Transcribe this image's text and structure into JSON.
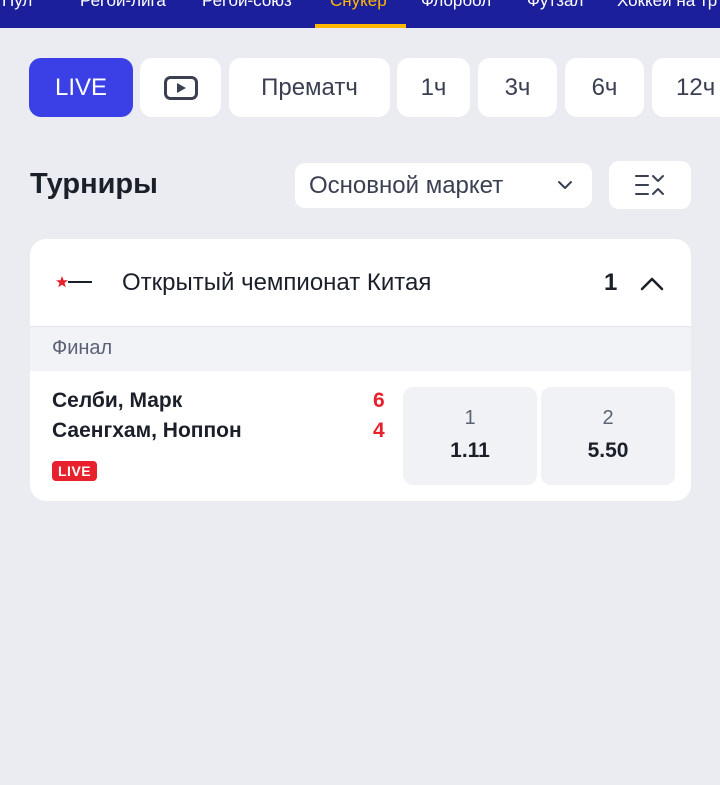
{
  "top_nav": {
    "items": [
      "Пул",
      "Регби-лига",
      "Регби-союз",
      "Снукер",
      "Флорбол",
      "Футзал",
      "Хоккей на тр"
    ],
    "active_index": 3
  },
  "filters": {
    "live_label": "LIVE",
    "video_icon": "play-icon",
    "prematch_label": "Прематч",
    "h1": "1ч",
    "h3": "3ч",
    "h6": "6ч",
    "h12": "12ч"
  },
  "section": {
    "title": "Турниры",
    "market_select": "Основной маркет",
    "collapse_icon": "collapse-all-icon"
  },
  "tournament": {
    "name": "Открытый чемпионат Китая",
    "count": "1",
    "stage": "Финал",
    "match": {
      "home": "Селби, Марк",
      "away": "Саенгхам, Ноппон",
      "home_score": "6",
      "away_score": "4",
      "live_badge": "LIVE",
      "odds": [
        {
          "label": "1",
          "value": "1.11"
        },
        {
          "label": "2",
          "value": "5.50"
        }
      ]
    }
  },
  "colors": {
    "nav_bg": "#1c1f9c",
    "active_accent": "#ffb800",
    "live_blue": "#3b3fe6",
    "live_red": "#e8222d",
    "page_bg": "#eaecf1"
  }
}
